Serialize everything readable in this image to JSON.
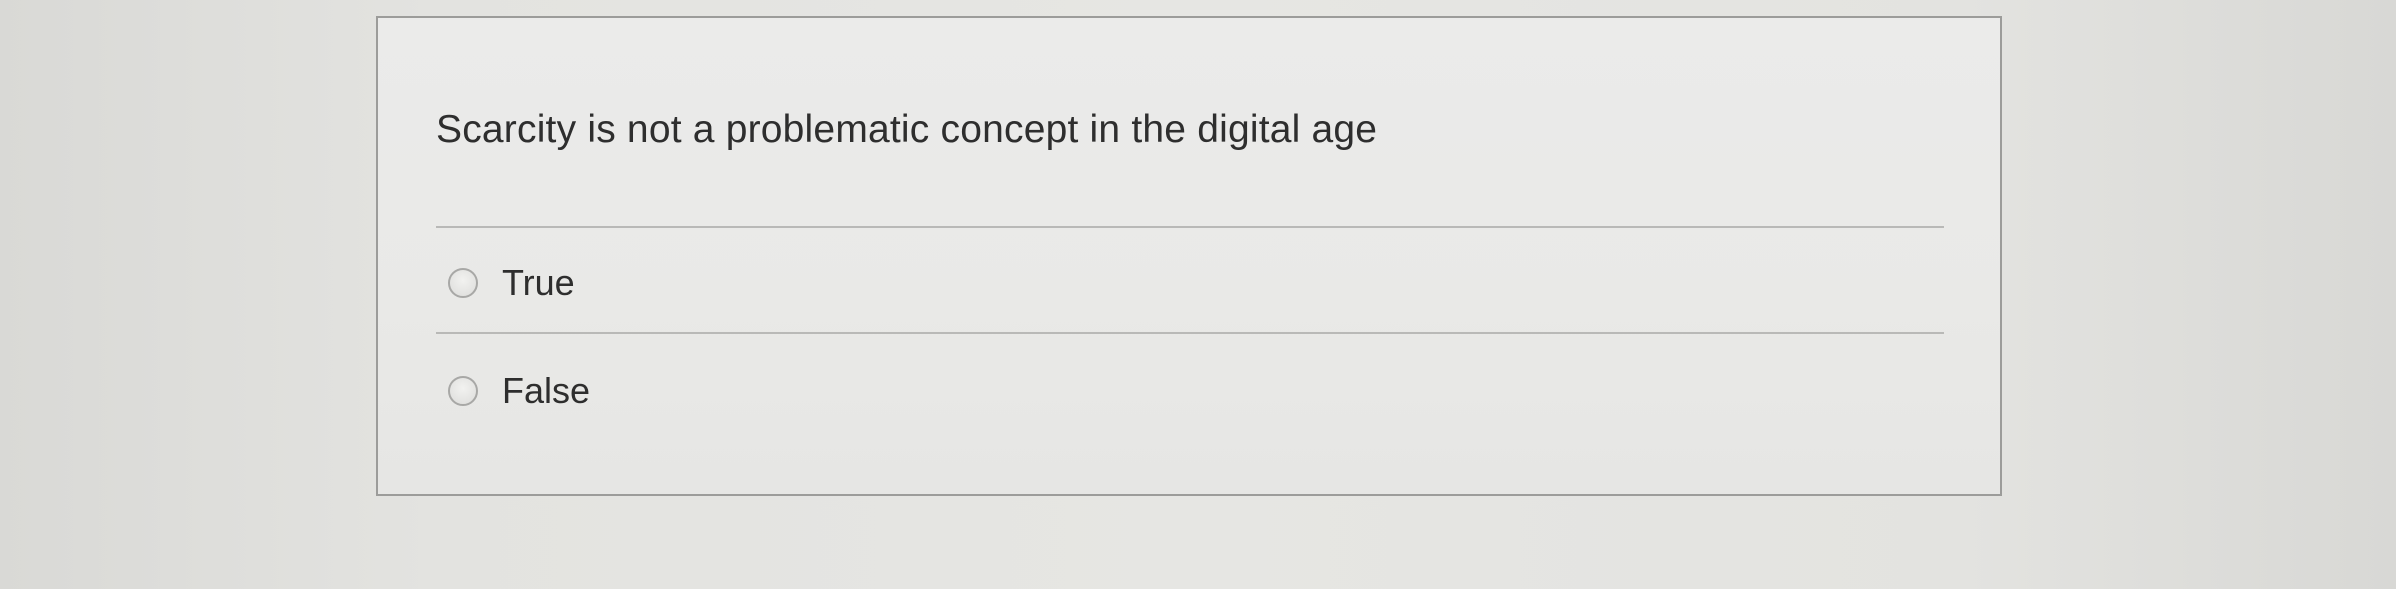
{
  "question": {
    "text": "Scarcity is not a problematic concept in the digital age",
    "options": [
      {
        "label": "True",
        "selected": false
      },
      {
        "label": "False",
        "selected": false
      }
    ]
  },
  "icons": {
    "radio": "radio-button-empty-icon"
  }
}
